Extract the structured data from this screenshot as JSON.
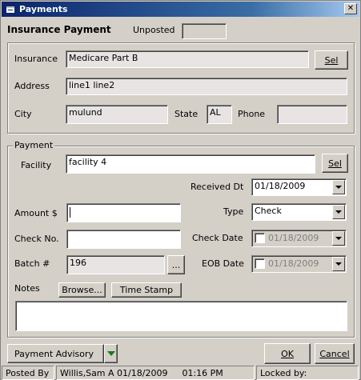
{
  "window": {
    "title": "Payments",
    "close_label": "✕"
  },
  "header": {
    "title": "Insurance Payment",
    "unposted_label": "Unposted",
    "unposted_value": ""
  },
  "insurance_group": {
    "insurance_label": "Insurance",
    "insurance_value": "Medicare Part B",
    "sel_button": "Sel",
    "address_label": "Address",
    "address_value": "line1 line2",
    "city_label": "City",
    "city_value": "mulund",
    "state_label": "State",
    "state_value": "AL",
    "phone_label": "Phone",
    "phone_value": ""
  },
  "payment_group": {
    "title": "Payment",
    "facility_label": "Facility",
    "facility_value": "facility 4",
    "sel_button": "Sel",
    "received_dt_label": "Received Dt",
    "received_dt_value": "01/18/2009",
    "amount_label": "Amount  $",
    "amount_value": "",
    "type_label": "Type",
    "type_value": "Check",
    "check_no_label": "Check No.",
    "check_no_value": "",
    "check_date_label": "Check Date",
    "check_date_value": "01/18/2009",
    "batch_label": "Batch #",
    "batch_value": "196",
    "batch_button": "...",
    "eob_date_label": "EOB Date",
    "eob_date_value": "01/18/2009",
    "notes_label": "Notes",
    "browse_button": "Browse...",
    "timestamp_button": "Time Stamp",
    "notes_value": ""
  },
  "footer": {
    "payment_advisory_button": "Payment Advisory",
    "ok_button": "OK",
    "cancel_button": "Cancel"
  },
  "statusbar": {
    "posted_by_label": "Posted By",
    "posted_by_value": "Willis,Sam A 01/18/2009",
    "time_value": "01:16 PM",
    "locked_by_label": "Locked by:",
    "locked_by_value": ""
  }
}
